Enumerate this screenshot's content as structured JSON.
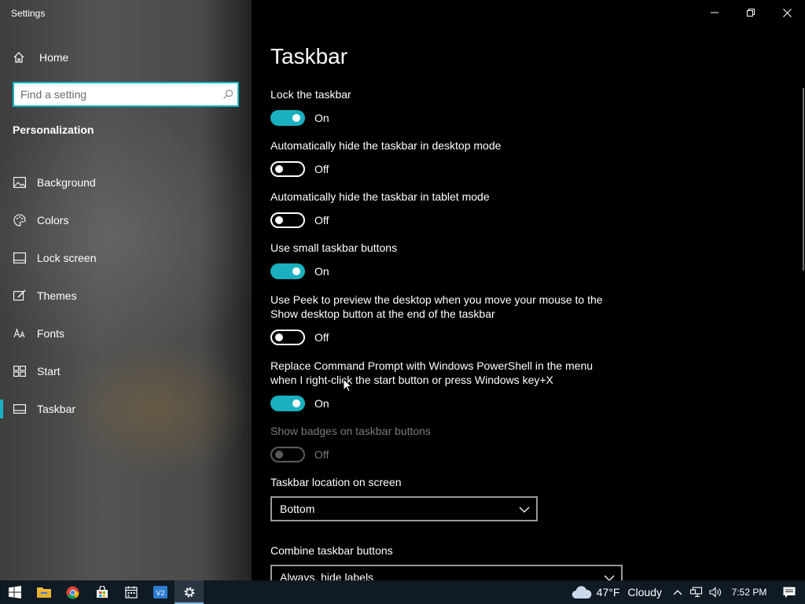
{
  "window": {
    "title": "Settings",
    "controls": [
      "minimize",
      "restore",
      "close"
    ]
  },
  "sidebar": {
    "home_label": "Home",
    "search_placeholder": "Find a setting",
    "section_title": "Personalization",
    "items": [
      {
        "label": "Background",
        "icon": "image-icon",
        "active": false
      },
      {
        "label": "Colors",
        "icon": "palette-icon",
        "active": false
      },
      {
        "label": "Lock screen",
        "icon": "lock-screen-icon",
        "active": false
      },
      {
        "label": "Themes",
        "icon": "brush-icon",
        "active": false
      },
      {
        "label": "Fonts",
        "icon": "font-icon",
        "active": false
      },
      {
        "label": "Start",
        "icon": "start-icon",
        "active": false
      },
      {
        "label": "Taskbar",
        "icon": "taskbar-icon",
        "active": true
      }
    ]
  },
  "main": {
    "title": "Taskbar",
    "settings": [
      {
        "label": "Lock the taskbar",
        "state": "On",
        "on": true,
        "disabled": false
      },
      {
        "label": "Automatically hide the taskbar in desktop mode",
        "state": "Off",
        "on": false,
        "disabled": false
      },
      {
        "label": "Automatically hide the taskbar in tablet mode",
        "state": "Off",
        "on": false,
        "disabled": false
      },
      {
        "label": "Use small taskbar buttons",
        "state": "On",
        "on": true,
        "disabled": false
      },
      {
        "label": "Use Peek to preview the desktop when you move your mouse to the Show desktop button at the end of the taskbar",
        "state": "Off",
        "on": false,
        "disabled": false
      },
      {
        "label": "Replace Command Prompt with Windows PowerShell in the menu when I right-click the start button or press Windows key+X",
        "state": "On",
        "on": true,
        "disabled": false
      },
      {
        "label": "Show badges on taskbar buttons",
        "state": "Off",
        "on": false,
        "disabled": true
      }
    ],
    "location": {
      "label": "Taskbar location on screen",
      "value": "Bottom"
    },
    "combine": {
      "label": "Combine taskbar buttons",
      "value": "Always, hide labels"
    }
  },
  "taskbar": {
    "apps": [
      "start-icon",
      "file-explorer-icon",
      "chrome-icon",
      "store-icon",
      "calendar-icon",
      "vs-code-icon",
      "settings-icon"
    ],
    "weather_temp": "47°F",
    "weather_desc": "Cloudy",
    "time": "7:52 PM"
  },
  "colors": {
    "accent": "#1ab0c0",
    "taskbar": "#101a24"
  }
}
